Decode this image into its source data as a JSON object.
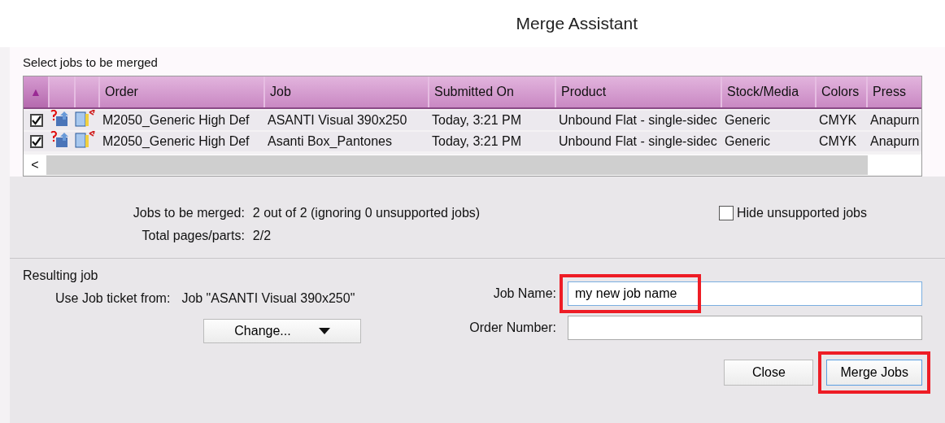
{
  "window": {
    "title": "Merge Assistant"
  },
  "jobs_section": {
    "label": "Select jobs to be merged"
  },
  "table": {
    "sort_indicator": "▲",
    "columns": [
      {
        "label": "Order"
      },
      {
        "label": "Job"
      },
      {
        "label": "Submitted On"
      },
      {
        "label": "Product"
      },
      {
        "label": "Stock/Media"
      },
      {
        "label": "Colors"
      },
      {
        "label": "Press"
      }
    ],
    "rows": [
      {
        "checked": true,
        "cells": [
          "M2050_Generic High Def",
          "ASANTI Visual 390x250",
          "Today, 3:21 PM",
          "Unbound Flat - single-sidec",
          "Generic",
          "CMYK",
          "Anapurn"
        ]
      },
      {
        "checked": true,
        "cells": [
          "M2050_Generic High Def",
          "Asanti Box_Pantones",
          "Today, 3:21 PM",
          "Unbound Flat - single-sidec",
          "Generic",
          "CMYK",
          "Anapurn"
        ]
      }
    ],
    "scroll_left": "<"
  },
  "summary": [
    {
      "label": "Jobs to be merged:",
      "value": "2 out of 2 (ignoring 0 unsupported jobs)"
    },
    {
      "label": "Total pages/parts:",
      "value": "2/2"
    }
  ],
  "hide_unsupported": {
    "label": "Hide unsupported jobs",
    "checked": false
  },
  "resulting_job": {
    "heading": "Resulting job",
    "ticket_label": "Use Job ticket from:",
    "ticket_value": "Job \"ASANTI Visual 390x250\"",
    "change_button": "Change...",
    "fields": [
      {
        "label": "Job Name:",
        "value": "my new job name",
        "highlighted": true
      },
      {
        "label": "Order Number:",
        "highlighted": false
      }
    ]
  },
  "buttons": [
    {
      "label": "Close",
      "highlighted": false,
      "default": false
    },
    {
      "label": "Merge Jobs",
      "highlighted": true,
      "default": true
    }
  ]
}
